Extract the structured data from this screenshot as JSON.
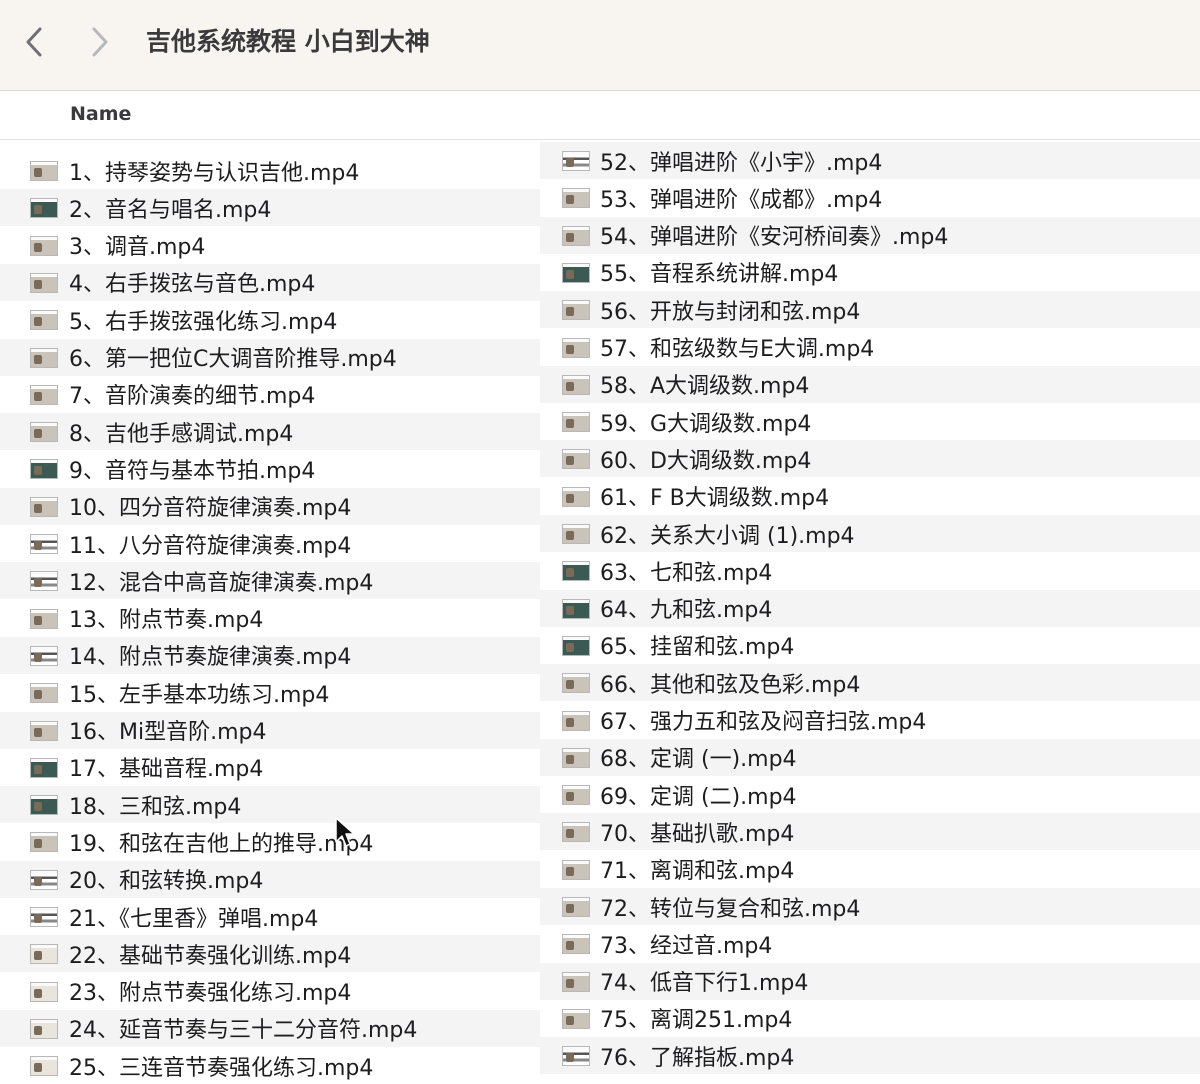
{
  "window": {
    "title": "吉他系统教程 小白到大神"
  },
  "header": {
    "name_column": "Name"
  },
  "files_left": [
    {
      "name": "1、持琴姿势与认识吉他.mp4",
      "thumb": "t-person"
    },
    {
      "name": "2、音名与唱名.mp4",
      "thumb": "t-dark"
    },
    {
      "name": "3、调音.mp4",
      "thumb": "t-person"
    },
    {
      "name": "4、右手拨弦与音色.mp4",
      "thumb": "t-person"
    },
    {
      "name": "5、右手拨弦强化练习.mp4",
      "thumb": "t-person"
    },
    {
      "name": "6、第一把位C大调音阶推导.mp4",
      "thumb": "t-person"
    },
    {
      "name": "7、音阶演奏的细节.mp4",
      "thumb": "t-person"
    },
    {
      "name": "8、吉他手感调试.mp4",
      "thumb": "t-person"
    },
    {
      "name": "9、音符与基本节拍.mp4",
      "thumb": "t-dark"
    },
    {
      "name": "10、四分音符旋律演奏.mp4",
      "thumb": "t-person"
    },
    {
      "name": "11、八分音符旋律演奏.mp4",
      "thumb": "t-stripe"
    },
    {
      "name": "12、混合中高音旋律演奏.mp4",
      "thumb": "t-stripe"
    },
    {
      "name": "13、附点节奏.mp4",
      "thumb": "t-person"
    },
    {
      "name": "14、附点节奏旋律演奏.mp4",
      "thumb": "t-stripe"
    },
    {
      "name": "15、左手基本功练习.mp4",
      "thumb": "t-person"
    },
    {
      "name": "16、Mi型音阶.mp4",
      "thumb": "t-person"
    },
    {
      "name": "17、基础音程.mp4",
      "thumb": "t-dark"
    },
    {
      "name": "18、三和弦.mp4",
      "thumb": "t-dark"
    },
    {
      "name": "19、和弦在吉他上的推导.mp4",
      "thumb": "t-person"
    },
    {
      "name": "20、和弦转换.mp4",
      "thumb": "t-stripe"
    },
    {
      "name": "21、《七里香》弹唱.mp4",
      "thumb": "t-stripe"
    },
    {
      "name": "22、基础节奏强化训练.mp4",
      "thumb": "t-light"
    },
    {
      "name": "23、附点节奏强化练习.mp4",
      "thumb": "t-light"
    },
    {
      "name": "24、延音节奏与三十二分音符.mp4",
      "thumb": "t-light"
    },
    {
      "name": "25、三连音节奏强化练习.mp4",
      "thumb": "t-light"
    }
  ],
  "files_right": [
    {
      "name": "52、弹唱进阶《小宇》.mp4",
      "thumb": "t-stripe"
    },
    {
      "name": "53、弹唱进阶《成都》.mp4",
      "thumb": "t-person"
    },
    {
      "name": "54、弹唱进阶《安河桥间奏》.mp4",
      "thumb": "t-person"
    },
    {
      "name": "55、音程系统讲解.mp4",
      "thumb": "t-dark"
    },
    {
      "name": "56、开放与封闭和弦.mp4",
      "thumb": "t-person"
    },
    {
      "name": "57、和弦级数与E大调.mp4",
      "thumb": "t-person"
    },
    {
      "name": "58、A大调级数.mp4",
      "thumb": "t-person"
    },
    {
      "name": "59、G大调级数.mp4",
      "thumb": "t-person"
    },
    {
      "name": "60、D大调级数.mp4",
      "thumb": "t-person"
    },
    {
      "name": "61、F B大调级数.mp4",
      "thumb": "t-person"
    },
    {
      "name": "62、关系大小调 (1).mp4",
      "thumb": "t-person"
    },
    {
      "name": "63、七和弦.mp4",
      "thumb": "t-dark"
    },
    {
      "name": "64、九和弦.mp4",
      "thumb": "t-dark"
    },
    {
      "name": "65、挂留和弦.mp4",
      "thumb": "t-dark"
    },
    {
      "name": "66、其他和弦及色彩.mp4",
      "thumb": "t-person"
    },
    {
      "name": "67、强力五和弦及闷音扫弦.mp4",
      "thumb": "t-person"
    },
    {
      "name": "68、定调 (一).mp4",
      "thumb": "t-person"
    },
    {
      "name": "69、定调 (二).mp4",
      "thumb": "t-person"
    },
    {
      "name": "70、基础扒歌.mp4",
      "thumb": "t-person"
    },
    {
      "name": "71、离调和弦.mp4",
      "thumb": "t-person"
    },
    {
      "name": "72、转位与复合和弦.mp4",
      "thumb": "t-person"
    },
    {
      "name": "73、经过音.mp4",
      "thumb": "t-person"
    },
    {
      "name": "74、低音下行1.mp4",
      "thumb": "t-person"
    },
    {
      "name": "75、离调251.mp4",
      "thumb": "t-person"
    },
    {
      "name": "76、了解指板.mp4",
      "thumb": "t-stripe"
    }
  ]
}
